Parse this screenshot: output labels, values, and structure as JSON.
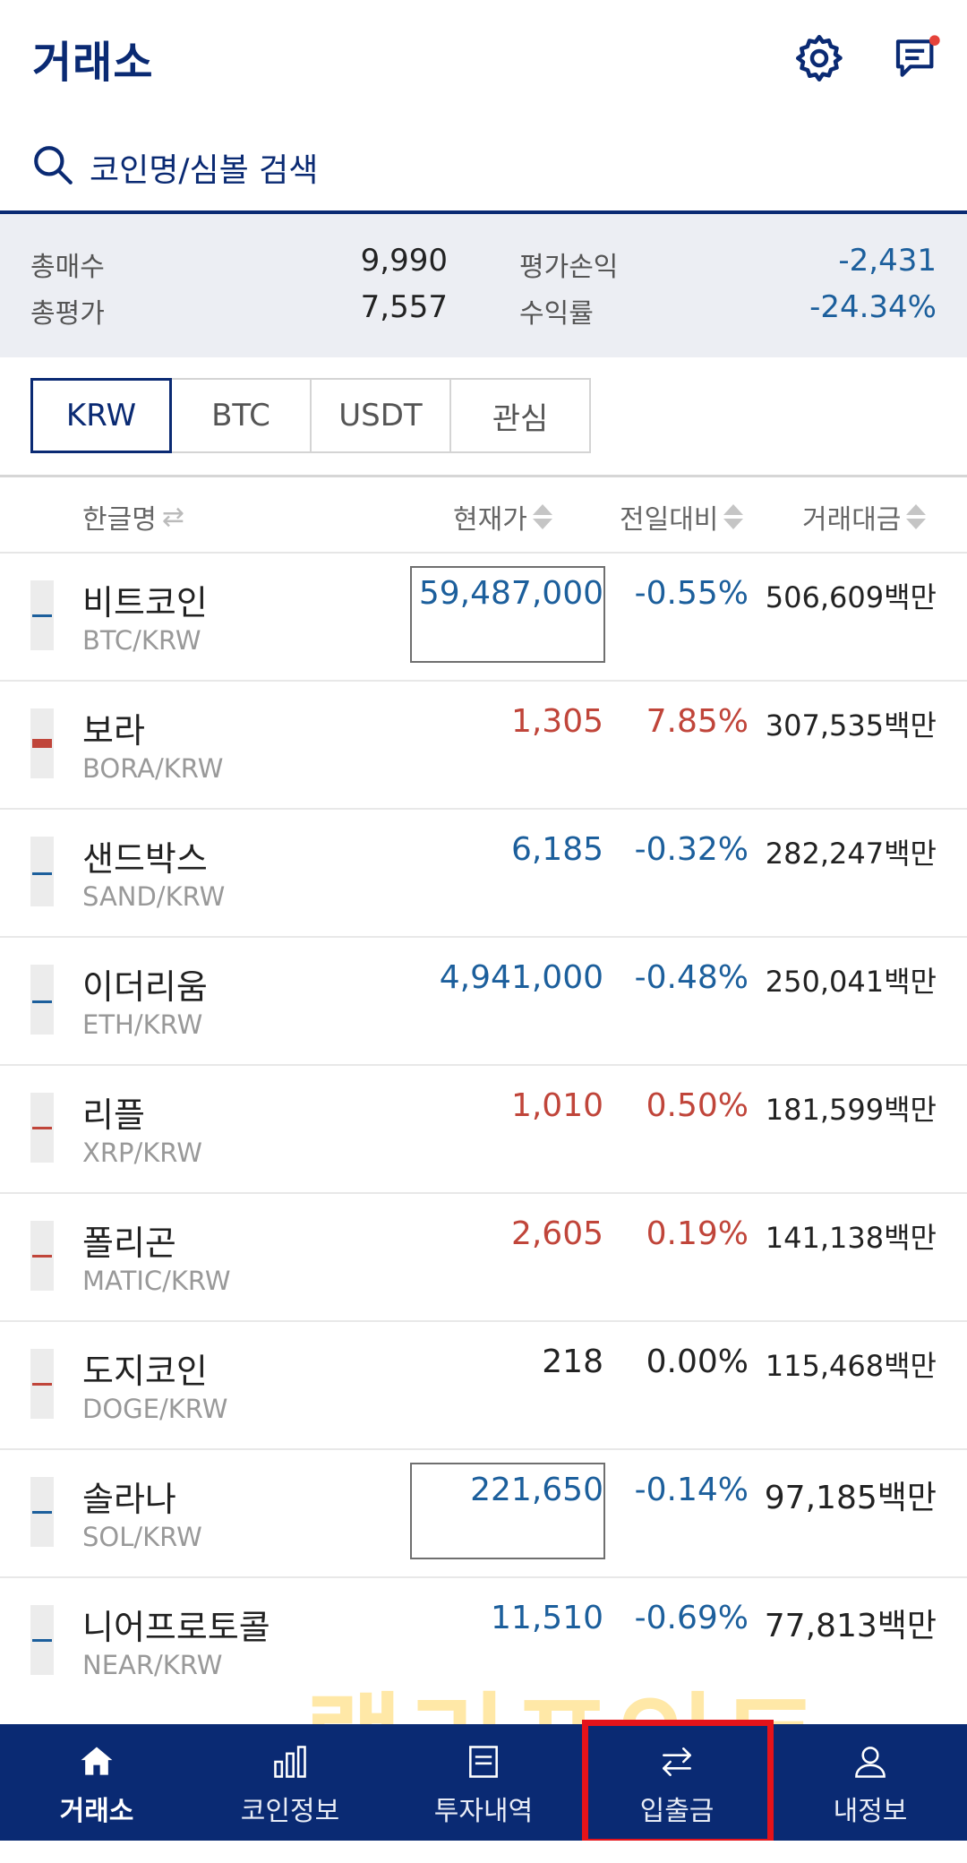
{
  "header": {
    "title": "거래소",
    "icons": [
      "gear-icon",
      "chat-icon"
    ]
  },
  "search": {
    "placeholder": "코인명/심볼 검색"
  },
  "summary": {
    "total_buy_label": "총매수",
    "total_buy_value": "9,990",
    "total_eval_label": "총평가",
    "total_eval_value": "7,557",
    "pnl_label": "평가손익",
    "pnl_value": "-2,431",
    "return_label": "수익률",
    "return_value": "-24.34%"
  },
  "tabs": [
    {
      "label": "KRW",
      "active": true
    },
    {
      "label": "BTC",
      "active": false
    },
    {
      "label": "USDT",
      "active": false
    },
    {
      "label": "관심",
      "active": false
    }
  ],
  "columns": {
    "name": "한글명",
    "price": "현재가",
    "change": "전일대비",
    "volume": "거래대금"
  },
  "coins": [
    {
      "name": "비트코인",
      "symbol": "BTC/KRW",
      "price": "59,487,000",
      "change": "-0.55%",
      "volume": "506,609백만",
      "trend": "down"
    },
    {
      "name": "보라",
      "symbol": "BORA/KRW",
      "price": "1,305",
      "change": "7.85%",
      "volume": "307,535백만",
      "trend": "up"
    },
    {
      "name": "샌드박스",
      "symbol": "SAND/KRW",
      "price": "6,185",
      "change": "-0.32%",
      "volume": "282,247백만",
      "trend": "down"
    },
    {
      "name": "이더리움",
      "symbol": "ETH/KRW",
      "price": "4,941,000",
      "change": "-0.48%",
      "volume": "250,041백만",
      "trend": "down"
    },
    {
      "name": "리플",
      "symbol": "XRP/KRW",
      "price": "1,010",
      "change": "0.50%",
      "volume": "181,599백만",
      "trend": "up"
    },
    {
      "name": "폴리곤",
      "symbol": "MATIC/KRW",
      "price": "2,605",
      "change": "0.19%",
      "volume": "141,138백만",
      "trend": "up"
    },
    {
      "name": "도지코인",
      "symbol": "DOGE/KRW",
      "price": "218",
      "change": "0.00%",
      "volume": "115,468백만",
      "trend": "flat"
    },
    {
      "name": "솔라나",
      "symbol": "SOL/KRW",
      "price": "221,650",
      "change": "-0.14%",
      "volume": "97,185백만",
      "trend": "down"
    },
    {
      "name": "니어프로토콜",
      "symbol": "NEAR/KRW",
      "price": "11,510",
      "change": "-0.69%",
      "volume": "77,813백만",
      "trend": "down"
    }
  ],
  "watermark": "랠리포인트",
  "nav": [
    {
      "label": "거래소",
      "icon": "home-icon",
      "active": true
    },
    {
      "label": "코인정보",
      "icon": "bar-chart-icon",
      "active": false
    },
    {
      "label": "투자내역",
      "icon": "document-icon",
      "active": false
    },
    {
      "label": "입출금",
      "icon": "transfer-icon",
      "active": false
    },
    {
      "label": "내정보",
      "icon": "user-icon",
      "active": false
    }
  ],
  "colors": {
    "brand": "#0a2a73",
    "down": "#1c5f9c",
    "up": "#c0453a",
    "highlight": "#e5131a"
  }
}
